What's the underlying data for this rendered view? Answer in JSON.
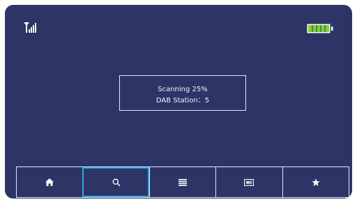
{
  "status_bar": {
    "signal_icon": "signal-icon",
    "battery_icon": "battery-icon",
    "battery_color": "#7bd135"
  },
  "scan_dialog": {
    "progress_text": "Scanning 25%",
    "station_text": "DAB Station：5"
  },
  "nav": {
    "active": "search",
    "items": [
      {
        "id": "home",
        "icon": "home-icon"
      },
      {
        "id": "search",
        "icon": "search-icon"
      },
      {
        "id": "list",
        "icon": "list-icon"
      },
      {
        "id": "slideshow",
        "icon": "slideshow-icon"
      },
      {
        "id": "favorites",
        "icon": "star-icon"
      }
    ]
  },
  "colors": {
    "background": "#2c3566",
    "accent": "#29a8e9",
    "text": "#f2f3f8"
  }
}
